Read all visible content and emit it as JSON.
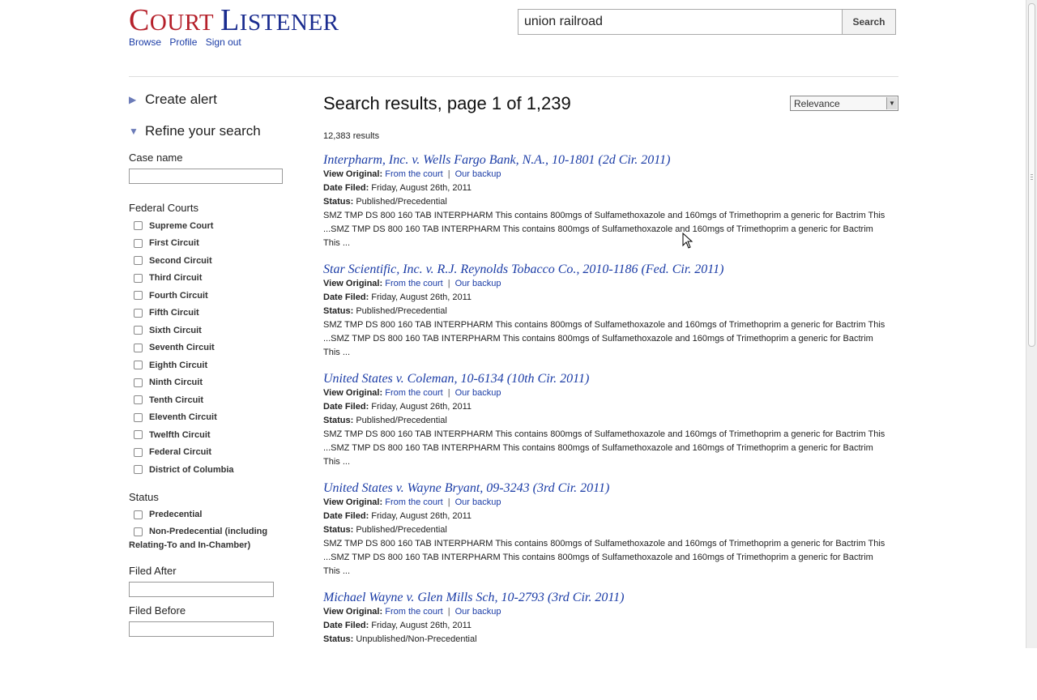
{
  "header": {
    "logo_first": {
      "cap": "C",
      "rest": "OURT"
    },
    "logo_second": {
      "cap": "L",
      "rest": "ISTENER"
    },
    "nav": [
      "Browse",
      "Profile",
      "Sign out"
    ],
    "search_query": "union railroad",
    "search_button": "Search",
    "colors": {
      "logo_accent": "#b5202a",
      "logo_primary": "#1a2c8f",
      "link": "#1b3ca6"
    }
  },
  "sidebar": {
    "create_alert": "Create alert",
    "refine": "Refine your search",
    "case_name_label": "Case name",
    "federal_courts_label": "Federal Courts",
    "courts": [
      "Supreme Court",
      "First Circuit",
      "Second Circuit",
      "Third Circuit",
      "Fourth Circuit",
      "Fifth Circuit",
      "Sixth Circuit",
      "Seventh Circuit",
      "Eighth Circuit",
      "Ninth Circuit",
      "Tenth Circuit",
      "Eleventh Circuit",
      "Twelfth Circuit",
      "Federal Circuit",
      "District of Columbia"
    ],
    "status_label": "Status",
    "status_predecential": "Predecential",
    "status_nonprec_line1": "Non-Predecential (including",
    "status_nonprec_line2": "Relating-To and In-Chamber)",
    "filed_after": "Filed After",
    "filed_before": "Filed Before"
  },
  "main": {
    "title": "Search results, page 1 of 1,239",
    "sort_value": "Relevance",
    "count": "12,383 results",
    "labels": {
      "view_original": "View Original:",
      "from_court": "From the court",
      "sep": "|",
      "our_backup": "Our backup",
      "date_filed": "Date Filed:",
      "status": "Status:"
    },
    "results": [
      {
        "title": "Interpharm, Inc. v. Wells Fargo Bank, N.A., 10-1801 (2d Cir. 2011)",
        "date": "Friday, August 26th, 2011",
        "status": "Published/Precedential",
        "snippet1": "SMZ TMP DS 800 160 TAB INTERPHARM This contains 800mgs of Sulfamethoxazole and 160mgs of Trimethoprim a generic for Bactrim This",
        "snippet2": "...SMZ TMP DS 800 160 TAB INTERPHARM This contains 800mgs of Sulfamethoxazole and 160mgs of Trimethoprim a generic for Bactrim",
        "snippet3": "This ..."
      },
      {
        "title": "Star Scientific, Inc. v. R.J. Reynolds Tobacco Co., 2010-1186 (Fed. Cir. 2011)",
        "date": "Friday, August 26th, 2011",
        "status": "Published/Precedential",
        "snippet1": "SMZ TMP DS 800 160 TAB INTERPHARM This contains 800mgs of Sulfamethoxazole and 160mgs of Trimethoprim a generic for Bactrim This",
        "snippet2": "...SMZ TMP DS 800 160 TAB INTERPHARM This contains 800mgs of Sulfamethoxazole and 160mgs of Trimethoprim a generic for Bactrim",
        "snippet3": "This ..."
      },
      {
        "title": "United States v. Coleman, 10-6134 (10th Cir. 2011)",
        "date": "Friday, August 26th, 2011",
        "status": "Published/Precedential",
        "snippet1": "SMZ TMP DS 800 160 TAB INTERPHARM This contains 800mgs of Sulfamethoxazole and 160mgs of Trimethoprim a generic for Bactrim This",
        "snippet2": "...SMZ TMP DS 800 160 TAB INTERPHARM This contains 800mgs of Sulfamethoxazole and 160mgs of Trimethoprim a generic for Bactrim",
        "snippet3": "This ..."
      },
      {
        "title": "United States v. Wayne Bryant, 09-3243 (3rd Cir. 2011)",
        "date": "Friday, August 26th, 2011",
        "status": "Published/Precedential",
        "snippet1": "SMZ TMP DS 800 160 TAB INTERPHARM This contains 800mgs of Sulfamethoxazole and 160mgs of Trimethoprim a generic for Bactrim This",
        "snippet2": "...SMZ TMP DS 800 160 TAB INTERPHARM This contains 800mgs of Sulfamethoxazole and 160mgs of Trimethoprim a generic for Bactrim",
        "snippet3": "This ..."
      },
      {
        "title": "Michael Wayne v. Glen Mills Sch, 10-2793 (3rd Cir. 2011)",
        "date": "Friday, August 26th, 2011",
        "status": "Unpublished/Non-Precedential",
        "snippet1": "",
        "snippet2": "",
        "snippet3": ""
      }
    ]
  },
  "icons": {
    "collapsed": "triangle-right-icon",
    "expanded": "triangle-down-icon",
    "cursor": "mouse-pointer-icon",
    "dropdown": "dropdown-arrow-icon"
  }
}
